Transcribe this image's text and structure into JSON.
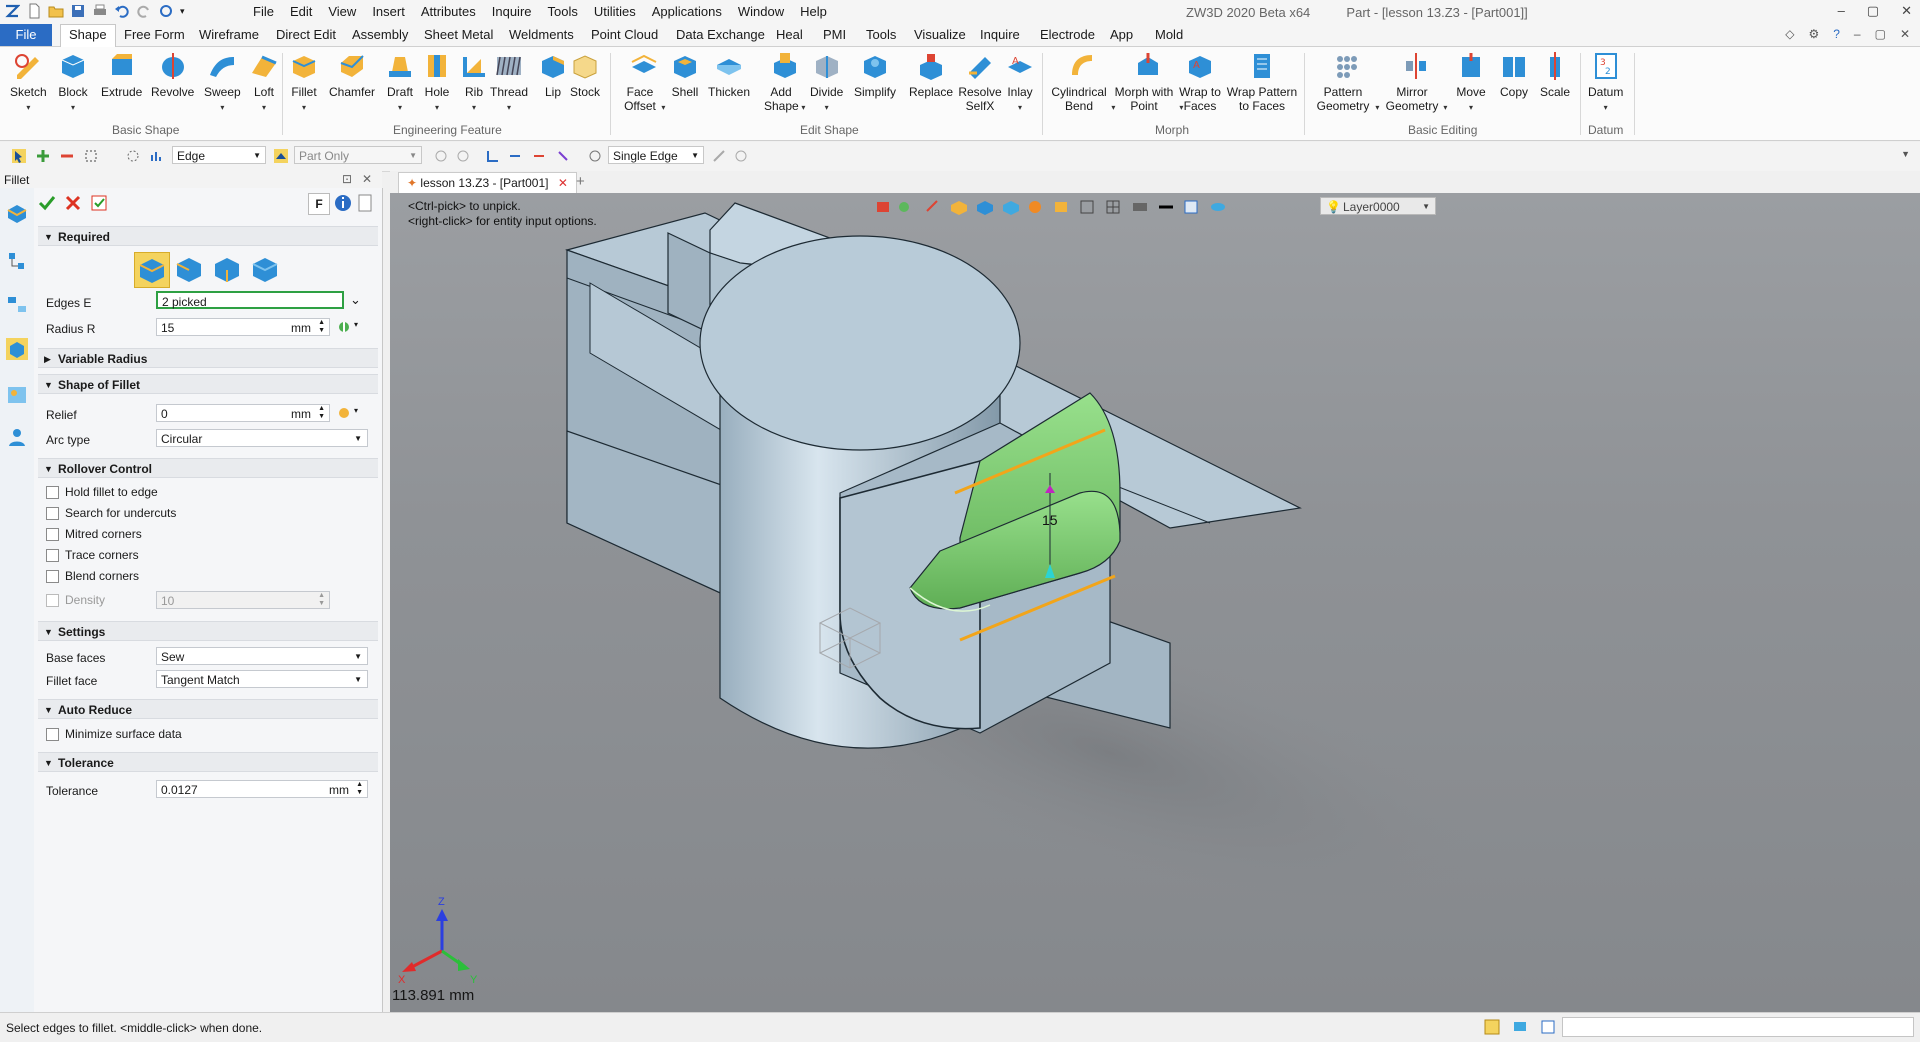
{
  "app": {
    "window_title": "ZW3D 2020 Beta x64",
    "doc_title": "Part - [lesson 13.Z3 - [Part001]]",
    "menu": [
      "File",
      "Edit",
      "View",
      "Insert",
      "Attributes",
      "Inquire",
      "Tools",
      "Utilities",
      "Applications",
      "Window",
      "Help"
    ]
  },
  "ribbon_tabs": [
    "File",
    "Shape",
    "Free Form",
    "Wireframe",
    "Direct Edit",
    "Assembly",
    "Sheet Metal",
    "Weldments",
    "Point Cloud",
    "Data Exchange",
    "Heal",
    "PMI",
    "Tools",
    "Visualize",
    "Inquire",
    "Electrode",
    "App",
    "Mold"
  ],
  "ribbon": {
    "groups": [
      "Basic Shape",
      "Engineering Feature",
      "Edit Shape",
      "Morph",
      "Basic Editing",
      "Datum"
    ],
    "basic_shape": [
      "Sketch",
      "Block",
      "Extrude",
      "Revolve",
      "Sweep",
      "Loft"
    ],
    "engineering_feature": [
      "Fillet",
      "Chamfer",
      "Draft",
      "Hole",
      "Rib",
      "Thread",
      "Lip",
      "Stock"
    ],
    "edit_shape": [
      "Face Offset",
      "Shell",
      "Thicken",
      "Add Shape",
      "Divide",
      "Simplify",
      "Replace",
      "Resolve SelfX",
      "Inlay"
    ],
    "morph": [
      "Cylindrical Bend",
      "Morph with Point",
      "Wrap to Faces",
      "Wrap Pattern to Faces"
    ],
    "basic_editing": [
      "Pattern Geometry",
      "Mirror Geometry",
      "Move",
      "Copy",
      "Scale"
    ],
    "datum": [
      "Datum"
    ]
  },
  "toolbar": {
    "filter": "Edge",
    "scope": "Part Only",
    "pick_mode": "Single Edge"
  },
  "panel": {
    "title": "Fillet",
    "f_button": "F",
    "required": {
      "title": "Required",
      "edges_label": "Edges E",
      "edges_value": "2 picked",
      "radius_label": "Radius R",
      "radius_value": "15",
      "radius_unit": "mm"
    },
    "variable_radius": {
      "title": "Variable Radius"
    },
    "shape": {
      "title": "Shape of Fillet",
      "relief_label": "Relief",
      "relief_value": "0",
      "relief_unit": "mm",
      "arc_label": "Arc type",
      "arc_value": "Circular"
    },
    "rollover": {
      "title": "Rollover Control",
      "options": [
        "Hold fillet to edge",
        "Search for undercuts",
        "Mitred corners",
        "Trace corners",
        "Blend corners"
      ],
      "density_label": "Density",
      "density_value": "10"
    },
    "settings": {
      "title": "Settings",
      "base_label": "Base faces",
      "base_value": "Sew",
      "fillet_face_label": "Fillet face",
      "fillet_face_value": "Tangent Match"
    },
    "auto_reduce": {
      "title": "Auto Reduce",
      "option": "Minimize surface data"
    },
    "tolerance": {
      "title": "Tolerance",
      "label": "Tolerance",
      "value": "0.0127",
      "unit": "mm"
    }
  },
  "doc_tab": "lesson 13.Z3 - [Part001]",
  "viewport": {
    "hint1": "<Ctrl-pick> to unpick.",
    "hint2": "<right-click> for entity input options.",
    "layer": "Layer0000",
    "dimension": "15",
    "scale": "113.891 mm",
    "axis_x": "X",
    "axis_y": "Y",
    "axis_z": "Z"
  },
  "status": {
    "message": "Select edges to fillet.  <middle-click> when done."
  },
  "colors": {
    "accent": "#2b6cc4",
    "model": "#a9bfcc",
    "fillet": "#86d47e",
    "edge_highlight": "#f2a51a"
  }
}
